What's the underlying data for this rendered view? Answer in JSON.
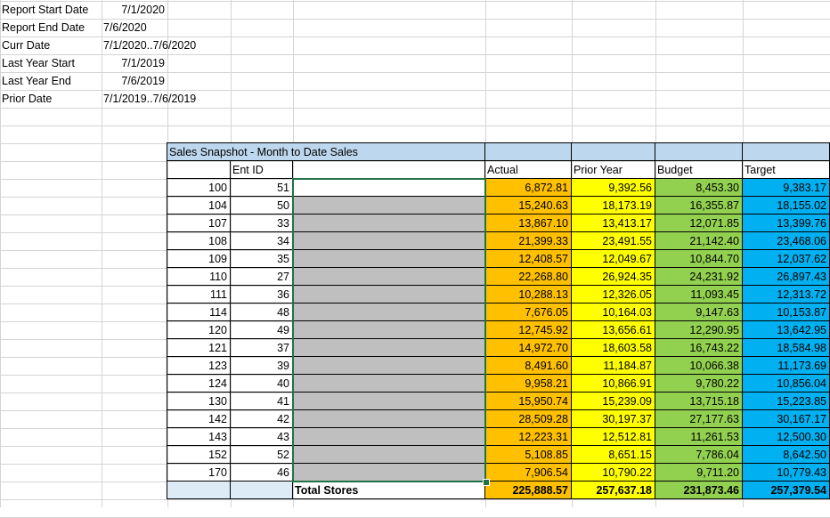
{
  "params": [
    {
      "label": "Report Start Date",
      "value": "7/1/2020",
      "align": "r"
    },
    {
      "label": "Report End Date",
      "value": "7/6/2020",
      "align": "l"
    },
    {
      "label": "Curr Date",
      "value": "7/1/2020..7/6/2020",
      "align": "l"
    },
    {
      "label": "Last Year Start",
      "value": "7/1/2019",
      "align": "r"
    },
    {
      "label": "Last Year End",
      "value": "7/6/2019",
      "align": "r"
    },
    {
      "label": "Prior Date",
      "value": "7/1/2019..7/6/2019",
      "align": "l"
    }
  ],
  "table": {
    "title": "Sales Snapshot - Month to Date Sales",
    "headers": {
      "ent_id": "Ent ID",
      "actual": "Actual",
      "prior_year": "Prior Year",
      "budget": "Budget",
      "target": "Target"
    },
    "rows": [
      {
        "store": "100",
        "ent": "51",
        "actual": "6,872.81",
        "prior": "9,392.56",
        "budget": "8,453.30",
        "target": "9,383.17"
      },
      {
        "store": "104",
        "ent": "50",
        "actual": "15,240.63",
        "prior": "18,173.19",
        "budget": "16,355.87",
        "target": "18,155.02"
      },
      {
        "store": "107",
        "ent": "33",
        "actual": "13,867.10",
        "prior": "13,413.17",
        "budget": "12,071.85",
        "target": "13,399.76"
      },
      {
        "store": "108",
        "ent": "34",
        "actual": "21,399.33",
        "prior": "23,491.55",
        "budget": "21,142.40",
        "target": "23,468.06"
      },
      {
        "store": "109",
        "ent": "35",
        "actual": "12,408.57",
        "prior": "12,049.67",
        "budget": "10,844.70",
        "target": "12,037.62"
      },
      {
        "store": "110",
        "ent": "27",
        "actual": "22,268.80",
        "prior": "26,924.35",
        "budget": "24,231.92",
        "target": "26,897.43"
      },
      {
        "store": "111",
        "ent": "36",
        "actual": "10,288.13",
        "prior": "12,326.05",
        "budget": "11,093.45",
        "target": "12,313.72"
      },
      {
        "store": "114",
        "ent": "48",
        "actual": "7,676.05",
        "prior": "10,164.03",
        "budget": "9,147.63",
        "target": "10,153.87"
      },
      {
        "store": "120",
        "ent": "49",
        "actual": "12,745.92",
        "prior": "13,656.61",
        "budget": "12,290.95",
        "target": "13,642.95"
      },
      {
        "store": "121",
        "ent": "37",
        "actual": "14,972.70",
        "prior": "18,603.58",
        "budget": "16,743.22",
        "target": "18,584.98"
      },
      {
        "store": "123",
        "ent": "39",
        "actual": "8,491.60",
        "prior": "11,184.87",
        "budget": "10,066.38",
        "target": "11,173.69"
      },
      {
        "store": "124",
        "ent": "40",
        "actual": "9,958.21",
        "prior": "10,866.91",
        "budget": "9,780.22",
        "target": "10,856.04"
      },
      {
        "store": "130",
        "ent": "41",
        "actual": "15,950.74",
        "prior": "15,239.09",
        "budget": "13,715.18",
        "target": "15,223.85"
      },
      {
        "store": "142",
        "ent": "42",
        "actual": "28,509.28",
        "prior": "30,197.37",
        "budget": "27,177.63",
        "target": "30,167.17"
      },
      {
        "store": "143",
        "ent": "43",
        "actual": "12,223.31",
        "prior": "12,512.81",
        "budget": "11,261.53",
        "target": "12,500.30"
      },
      {
        "store": "152",
        "ent": "52",
        "actual": "5,108.85",
        "prior": "8,651.15",
        "budget": "7,786.04",
        "target": "8,642.50"
      },
      {
        "store": "170",
        "ent": "46",
        "actual": "7,906.54",
        "prior": "10,790.22",
        "budget": "9,711.20",
        "target": "10,779.43"
      }
    ],
    "totals": {
      "label": "Total Stores",
      "actual": "225,888.57",
      "prior": "257,637.18",
      "budget": "231,873.46",
      "target": "257,379.54"
    }
  }
}
